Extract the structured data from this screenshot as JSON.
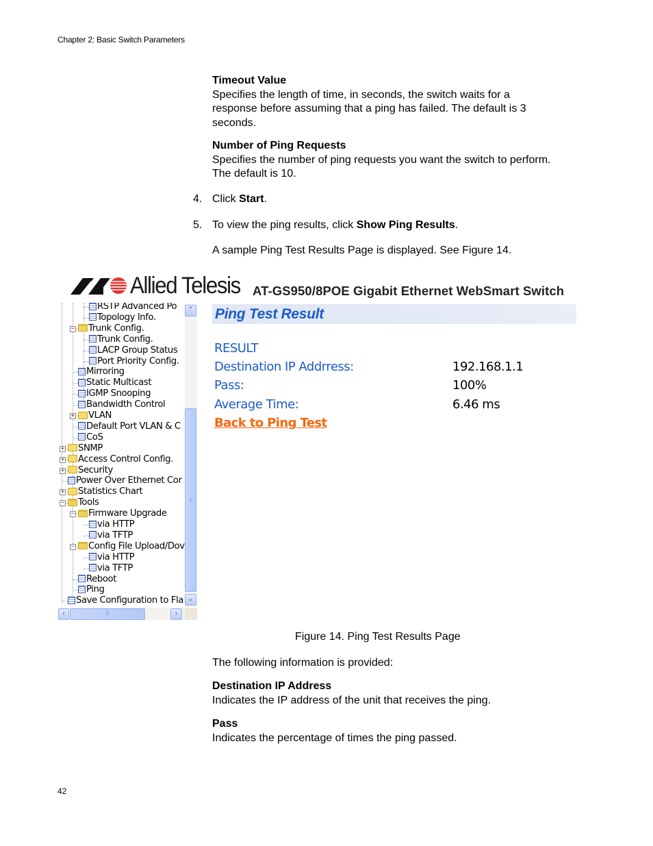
{
  "page": {
    "running_header": "Chapter 2: Basic Switch Parameters",
    "page_number": "42"
  },
  "intro": {
    "timeout": {
      "heading": "Timeout Value",
      "lines": [
        "Specifies the length of time, in seconds, the switch waits for a",
        "response before assuming that a ping has failed. The default is 3",
        "seconds."
      ]
    },
    "ping_requests": {
      "heading": "Number of Ping Requests",
      "lines": [
        "Specifies the number of ping requests you want the switch to perform.",
        "The default is 10."
      ]
    },
    "steps": [
      {
        "number": "4.",
        "prefix": "Click ",
        "bold": "Start",
        "suffix": "."
      },
      {
        "number": "5.",
        "prefix": "To view the ping results, click ",
        "bold": "Show Ping Results",
        "suffix": "."
      }
    ],
    "sample_note": "A sample Ping Test Results Page is displayed. See Figure 14."
  },
  "figure": {
    "brand": "Allied Telesis",
    "product_title": "AT-GS950/8POE Gigabit Ethernet WebSmart Switch",
    "tree": [
      {
        "label": "RSTP Advanced Po",
        "type": "doc"
      },
      {
        "label": "Topology Info.",
        "type": "doc"
      },
      {
        "label": "Trunk Config.",
        "type": "folder-open"
      },
      {
        "label": "Trunk Config.",
        "type": "doc"
      },
      {
        "label": "LACP Group Status",
        "type": "doc"
      },
      {
        "label": "Port Priority Config.",
        "type": "doc"
      },
      {
        "label": "Mirroring",
        "type": "doc"
      },
      {
        "label": "Static Multicast",
        "type": "doc"
      },
      {
        "label": "IGMP Snooping",
        "type": "doc"
      },
      {
        "label": "Bandwidth Control",
        "type": "doc"
      },
      {
        "label": "VLAN",
        "type": "folder"
      },
      {
        "label": "Default Port VLAN & C",
        "type": "doc"
      },
      {
        "label": "CoS",
        "type": "doc"
      },
      {
        "label": "SNMP",
        "type": "folder"
      },
      {
        "label": "Access Control Config.",
        "type": "folder"
      },
      {
        "label": "Security",
        "type": "folder"
      },
      {
        "label": "Power Over Ethernet Cor",
        "type": "doc"
      },
      {
        "label": "Statistics Chart",
        "type": "folder"
      },
      {
        "label": "Tools",
        "type": "folder-open"
      },
      {
        "label": "Firmware Upgrade",
        "type": "folder-open"
      },
      {
        "label": "via HTTP",
        "type": "doc"
      },
      {
        "label": "via TFTP",
        "type": "doc"
      },
      {
        "label": "Config File Upload/Dov",
        "type": "folder-open"
      },
      {
        "label": "via HTTP",
        "type": "doc"
      },
      {
        "label": "via TFTP",
        "type": "doc"
      },
      {
        "label": "Reboot",
        "type": "doc"
      },
      {
        "label": "Ping",
        "type": "doc"
      },
      {
        "label": "Save Configuration to Fla",
        "type": "doc"
      }
    ],
    "result": {
      "title": "Ping Test Result",
      "section_label": "RESULT",
      "rows": [
        {
          "label": "Destination IP Addrress:",
          "value": "192.168.1.1"
        },
        {
          "label": "Pass:",
          "value": "100%"
        },
        {
          "label": "Average Time:",
          "value": "6.46 ms"
        }
      ],
      "back_link": "Back to Ping Test"
    },
    "caption": "Figure 14. Ping Test Results Page"
  },
  "after": {
    "lead": "The following information is provided:",
    "dest_ip": {
      "heading": "Destination IP Address",
      "text": "Indicates the IP address of the unit that receives the ping."
    },
    "pass": {
      "heading": "Pass",
      "text": "Indicates the percentage of times the ping passed."
    }
  },
  "colors": {
    "link_blue": "#1b5cc6",
    "link_orange": "#f26a10",
    "header_band": "#e1e7f6"
  }
}
